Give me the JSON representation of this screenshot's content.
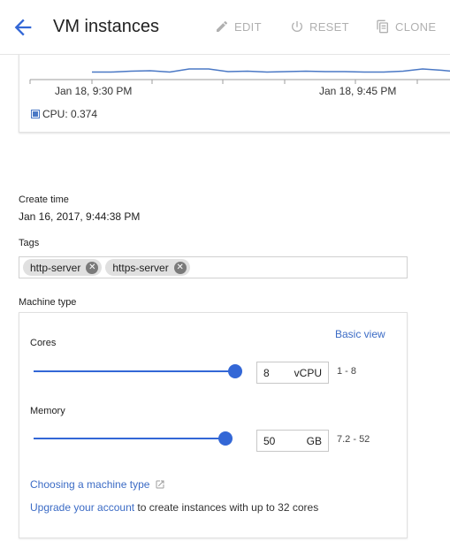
{
  "header": {
    "title": "VM instances",
    "buttons": {
      "edit": "EDIT",
      "reset": "RESET",
      "clone": "CLONE"
    }
  },
  "chart_data": {
    "type": "line",
    "x_tick_labels": [
      "Jan 18, 9:30 PM",
      "Jan 18, 9:45 PM"
    ],
    "series": [
      {
        "name": "CPU",
        "values": [
          0.33,
          0.33,
          0.35,
          0.36,
          0.33,
          0.4,
          0.4,
          0.34,
          0.35,
          0.33,
          0.34,
          0.35,
          0.34,
          0.34,
          0.33,
          0.33,
          0.35,
          0.4,
          0.37,
          0.33
        ]
      }
    ],
    "legend": {
      "label": "CPU: 0.374",
      "placement": "bottom-left"
    },
    "colors": {
      "line": "#4a78c5",
      "axis": "#9e9e9e"
    }
  },
  "details": {
    "create_time_label": "Create time",
    "create_time_value": "Jan 16, 2017, 9:44:38 PM",
    "tags_label": "Tags",
    "tags": [
      "http-server",
      "https-server"
    ],
    "machine_type_label": "Machine type"
  },
  "machine": {
    "basic_view": "Basic view",
    "cores": {
      "label": "Cores",
      "value": "8",
      "unit": "vCPU",
      "range": "1 - 8",
      "fraction": 1.0
    },
    "memory": {
      "label": "Memory",
      "value": "50",
      "unit": "GB",
      "range": "7.2 - 52",
      "fraction": 0.96
    },
    "choose_link": "Choosing a machine type",
    "upgrade_link": "Upgrade your account",
    "upgrade_suffix": " to create instances with up to 32 cores"
  },
  "colors": {
    "accent": "#3367d6",
    "link": "#3b6bc5",
    "disabled": "#b0b0b0"
  }
}
